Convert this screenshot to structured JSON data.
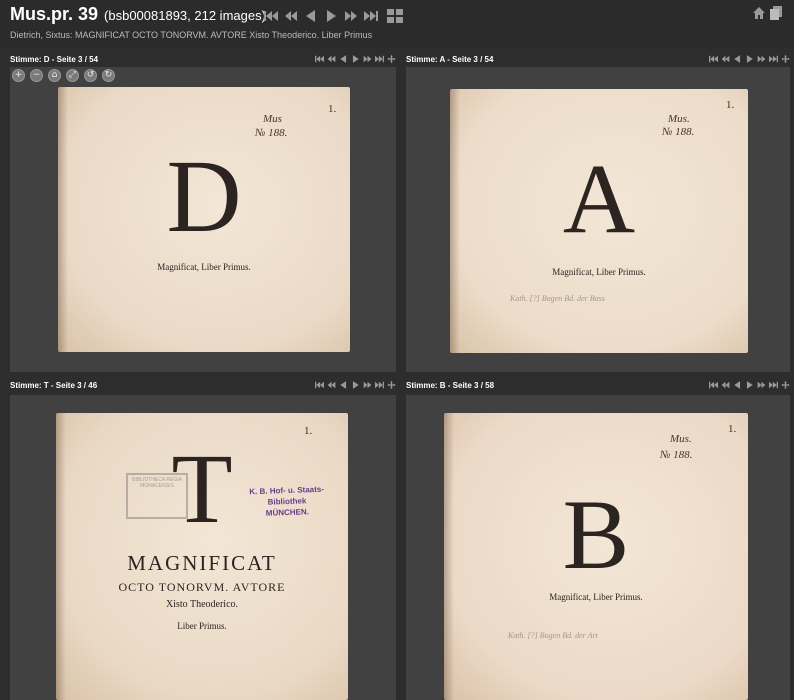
{
  "header": {
    "title": "Mus.pr. 39",
    "title_sub": "(bsb00081893, 212 images)",
    "subtitle": "Dietrich, Sixtus: MAGNIFICAT OCTO TONORVM. AVTORE Xisto Theoderico. Liber Primus"
  },
  "panels": [
    {
      "label": "Stimme: D - Seite 3 / 54",
      "shelfmark_1": "Mus",
      "shelfmark_2": "№ 188.",
      "folio": "1.",
      "letter": "D",
      "caption": "Magnificat, Liber Primus.",
      "pencil": "",
      "paper_color": "#ead9c6"
    },
    {
      "label": "Stimme: A - Seite 3 / 54",
      "shelfmark_1": "Mus.",
      "shelfmark_2": "№ 188.",
      "folio": "1.",
      "letter": "A",
      "caption": "Magnificat, Liber Primus.",
      "pencil": "Kath. [?] Bogen Bd. der Bass",
      "paper_color": "#ecdcc9"
    },
    {
      "label": "Stimme: T - Seite 3 / 46",
      "folio": "1.",
      "letter": "T",
      "title_line_1": "MAGNIFICAT",
      "title_line_2": "OCTO TONORVM. AVTORE",
      "title_line_3": "Xisto Theoderico.",
      "title_line_4": "Liber Primus.",
      "stamp_grey": "BIBLIOTHECA REGIA MONACENSIS",
      "stamp_purple_1": "K. B. Hof- u. Staats-",
      "stamp_purple_2": "Bibliothek",
      "stamp_purple_3": "MÜNCHEN.",
      "paper_color": "#e9d8c4"
    },
    {
      "label": "Stimme: B - Seite 3 / 58",
      "shelfmark_1": "Mus.",
      "shelfmark_2": "№ 188.",
      "folio": "1.",
      "letter": "B",
      "caption": "Magnificat, Liber Primus.",
      "pencil": "Kath. [?] Bogen Bd. der Art",
      "paper_color": "#ecd9c7"
    }
  ],
  "icons": {
    "first": "first-page-icon",
    "prev_fast": "fast-back-icon",
    "prev": "previous-icon",
    "next": "next-icon",
    "next_fast": "fast-forward-icon",
    "last": "last-page-icon",
    "move": "move-icon",
    "grid": "grid-view-icon",
    "home": "home-icon",
    "pages": "pages-icon"
  },
  "zoom_tools": [
    "+",
    "−",
    "⌂",
    "⤢",
    "↺",
    "↻"
  ],
  "colors": {
    "background": "#2d2d2d",
    "viewer": "#414141",
    "nav_icon": "#9a9a9a",
    "stamp_purple": "#6b3c8a"
  }
}
